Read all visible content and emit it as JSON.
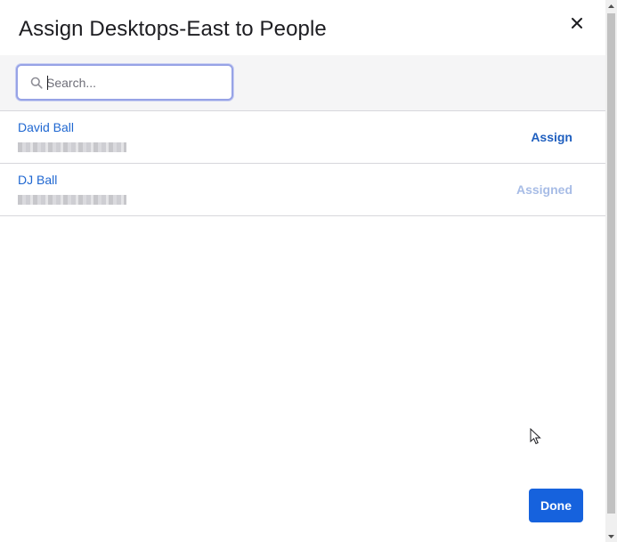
{
  "dialog": {
    "title": "Assign Desktops-East to People",
    "close_icon": "close-icon"
  },
  "search": {
    "placeholder": "Search...",
    "value": "",
    "icon": "search-icon"
  },
  "people": [
    {
      "name": "David Ball",
      "action": "Assign",
      "assigned": false
    },
    {
      "name": "DJ Ball",
      "action": "Assigned",
      "assigned": true
    }
  ],
  "footer": {
    "done_label": "Done"
  },
  "colors": {
    "link": "#1f67d1",
    "primary_button": "#1662dd",
    "assigned_disabled": "#a7bce6",
    "search_focus_border": "#97a3e6"
  }
}
